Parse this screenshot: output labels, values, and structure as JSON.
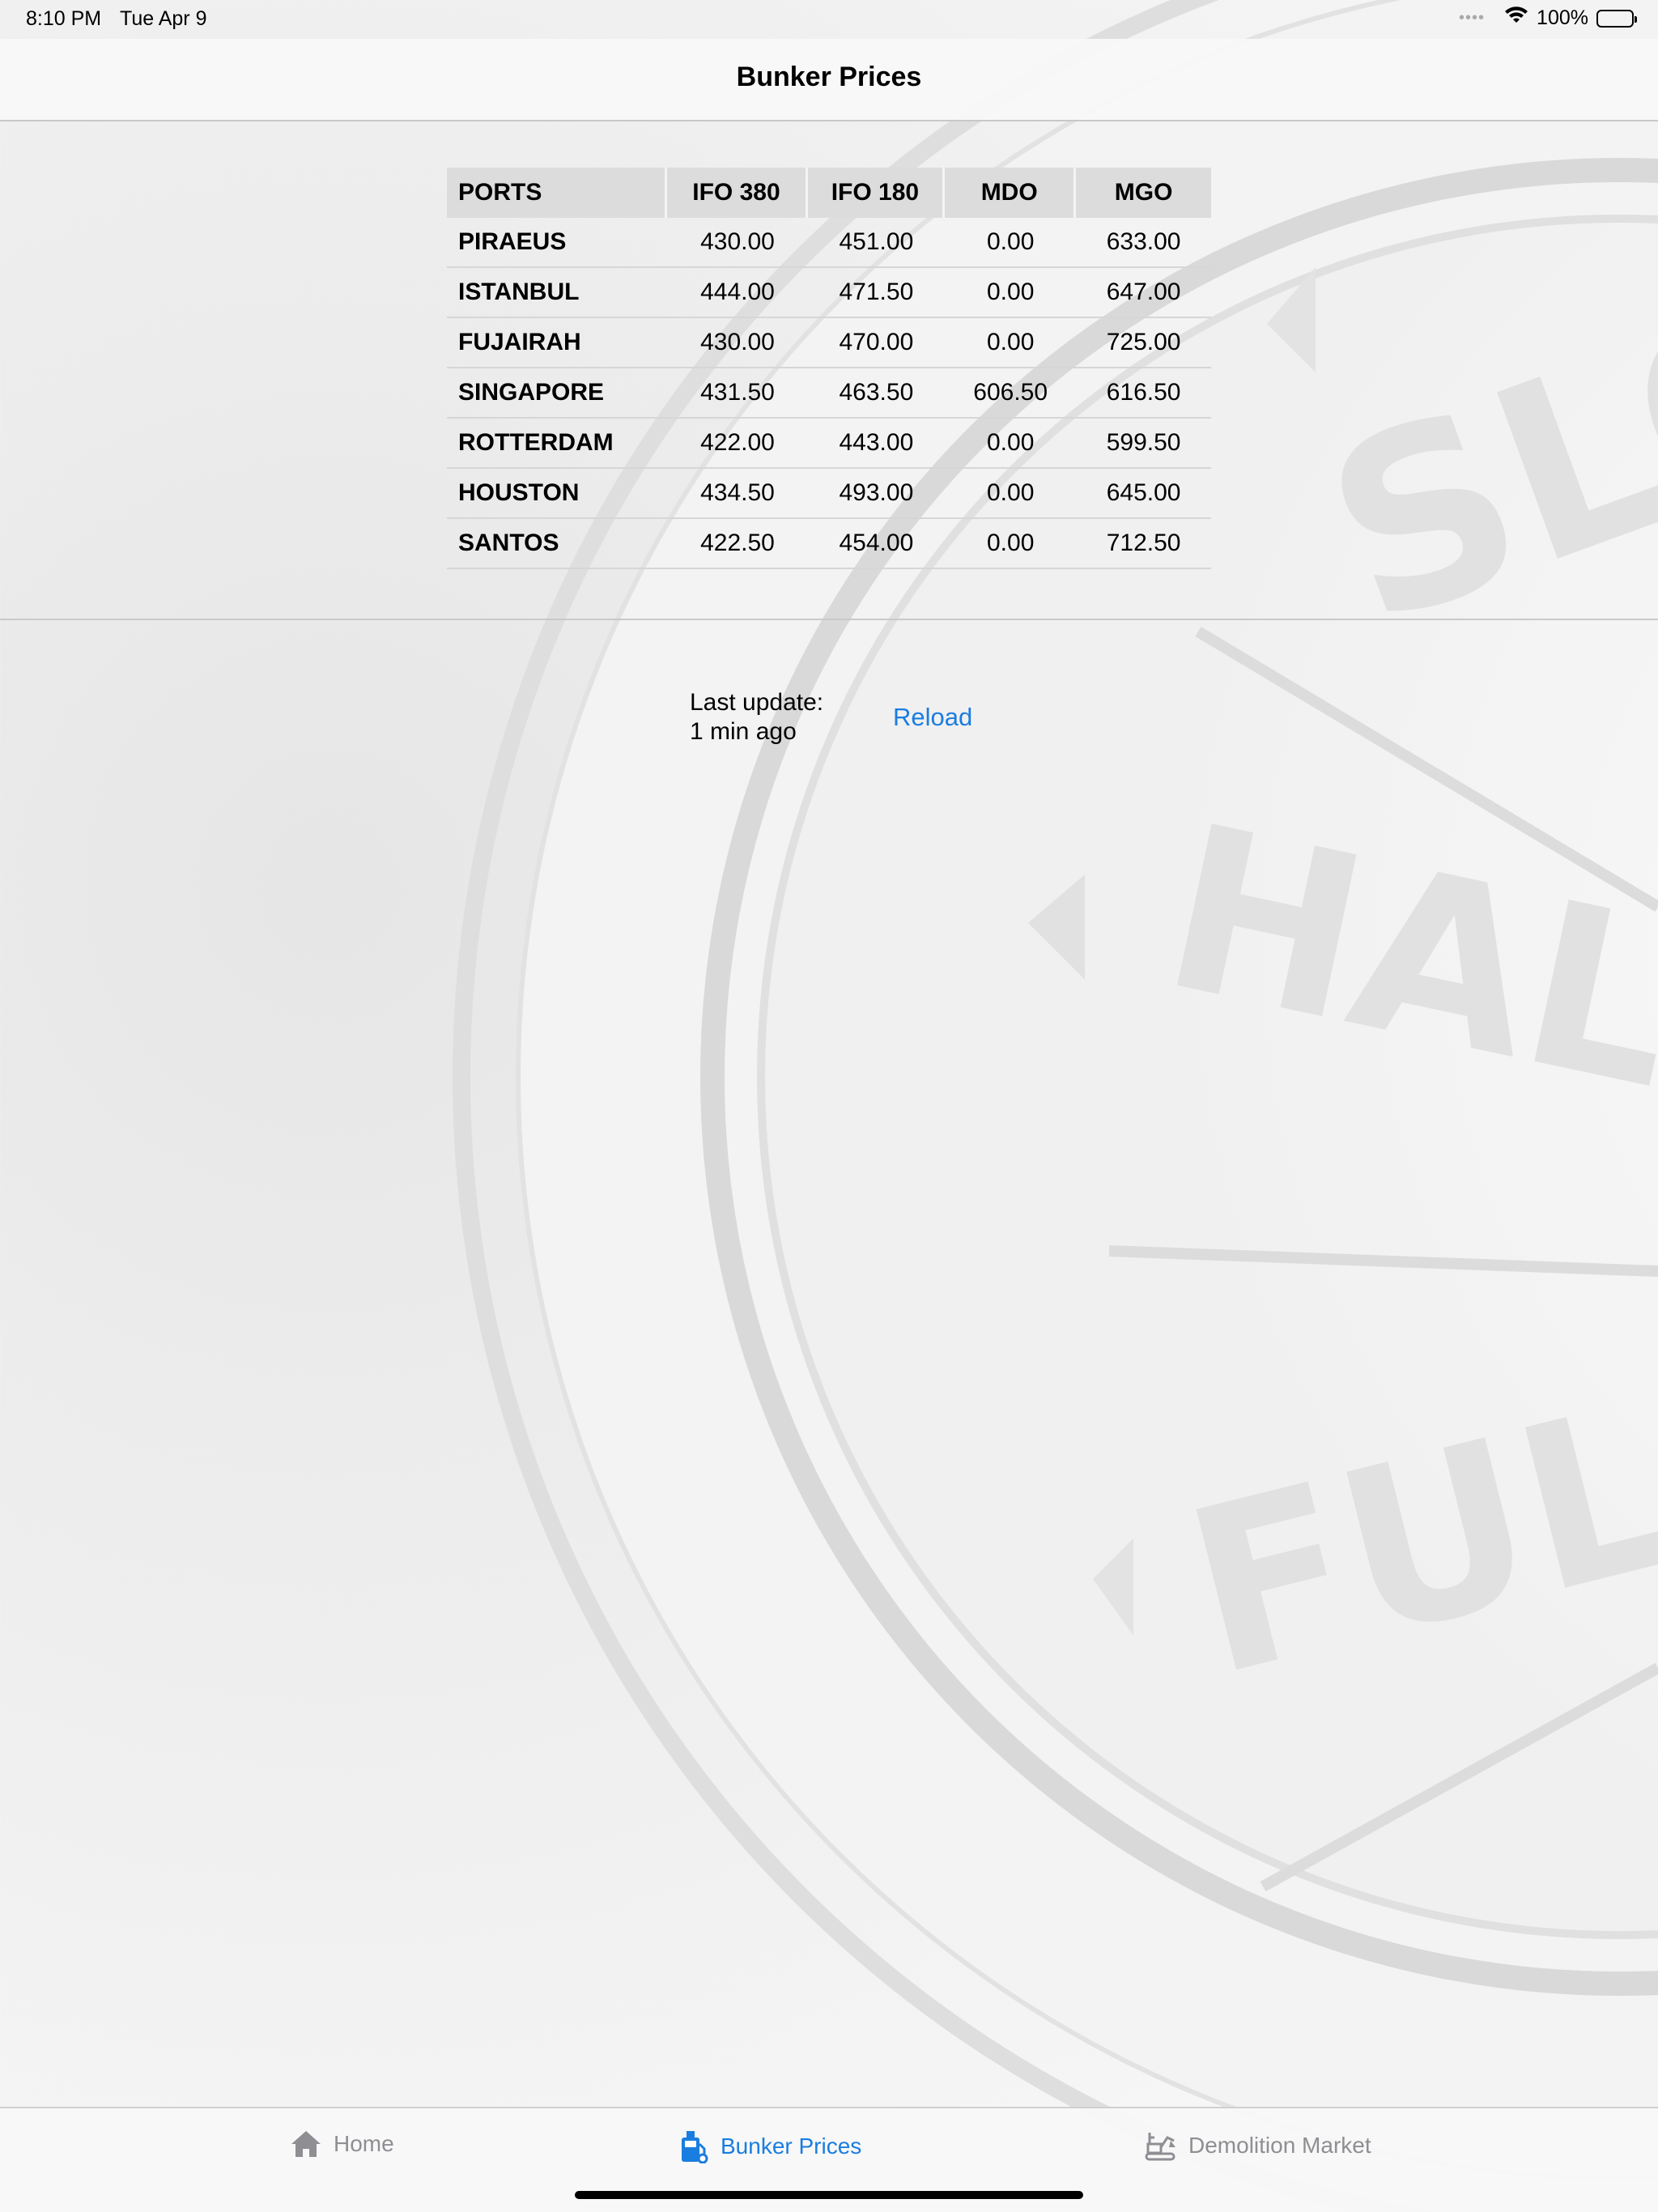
{
  "status_bar": {
    "time": "8:10 PM",
    "date": "Tue Apr 9",
    "battery": "100%"
  },
  "nav": {
    "title": "Bunker Prices"
  },
  "table": {
    "headers": [
      "PORTS",
      "IFO 380",
      "IFO 180",
      "MDO",
      "MGO"
    ],
    "rows": [
      [
        "PIRAEUS",
        "430.00",
        "451.00",
        "0.00",
        "633.00"
      ],
      [
        "ISTANBUL",
        "444.00",
        "471.50",
        "0.00",
        "647.00"
      ],
      [
        "FUJAIRAH",
        "430.00",
        "470.00",
        "0.00",
        "725.00"
      ],
      [
        "SINGAPORE",
        "431.50",
        "463.50",
        "606.50",
        "616.50"
      ],
      [
        "ROTTERDAM",
        "422.00",
        "443.00",
        "0.00",
        "599.50"
      ],
      [
        "HOUSTON",
        "434.50",
        "493.00",
        "0.00",
        "645.00"
      ],
      [
        "SANTOS",
        "422.50",
        "454.00",
        "0.00",
        "712.50"
      ]
    ]
  },
  "update": {
    "label": "Last update:",
    "value": "1 min ago",
    "reload_label": "Reload"
  },
  "tabs": [
    {
      "label": "Home",
      "icon": "home-icon",
      "active": false
    },
    {
      "label": "Bunker Prices",
      "icon": "fuel-pump-icon",
      "active": true
    },
    {
      "label": "Demolition Market",
      "icon": "excavator-icon",
      "active": false
    }
  ],
  "background": {
    "watermark_words": [
      "SLO",
      "HALF",
      "FUL"
    ]
  },
  "colors": {
    "accent": "#1a7de0",
    "inactive_tab": "#8e8e93",
    "table_header_bg": "#dcdcdc"
  }
}
